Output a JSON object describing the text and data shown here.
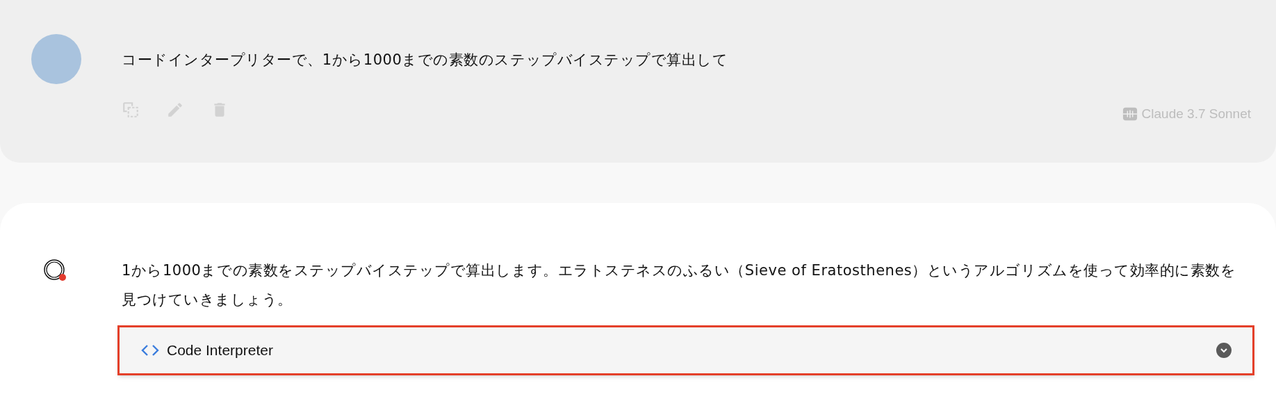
{
  "user_message": {
    "text": "コードインタープリターで、1から1000までの素数のステップバイステップで算出して",
    "model": "Claude 3.7 Sonnet"
  },
  "assistant_message": {
    "text": "1から1000までの素数をステップバイステップで算出します。エラトステネスのふるい（Sieve of Eratosthenes）というアルゴリズムを使って効率的に素数を見つけていきましょう。",
    "tool": {
      "label": "Code Interpreter",
      "expanded": false,
      "highlighted": true
    }
  }
}
